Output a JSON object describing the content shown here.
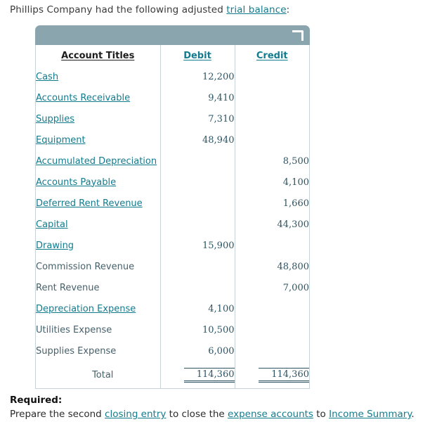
{
  "intro": {
    "text_before": "Phillips Company had the following adjusted ",
    "link": "trial balance",
    "text_after": ":"
  },
  "table": {
    "header_bar": {
      "corner_icon": "corner-bracket-icon"
    },
    "columns": {
      "account": "Account Titles",
      "debit": "Debit",
      "credit": "Credit"
    },
    "rows": [
      {
        "account": "Cash",
        "is_link": true,
        "debit": "12,200",
        "credit": ""
      },
      {
        "account": "Accounts Receivable",
        "is_link": true,
        "debit": "9,410",
        "credit": ""
      },
      {
        "account": "Supplies",
        "is_link": true,
        "debit": "7,310",
        "credit": ""
      },
      {
        "account": "Equipment",
        "is_link": true,
        "debit": "48,940",
        "credit": ""
      },
      {
        "account": "Accumulated Depreciation",
        "is_link": true,
        "debit": "",
        "credit": "8,500"
      },
      {
        "account": "Accounts Payable",
        "is_link": true,
        "debit": "",
        "credit": "4,100"
      },
      {
        "account": "Deferred Rent Revenue",
        "is_link": true,
        "debit": "",
        "credit": "1,660"
      },
      {
        "account": "Capital",
        "is_link": true,
        "debit": "",
        "credit": "44,300"
      },
      {
        "account": "Drawing",
        "is_link": true,
        "debit": "15,900",
        "credit": ""
      },
      {
        "account": "Commission Revenue",
        "is_link": false,
        "debit": "",
        "credit": "48,800"
      },
      {
        "account": "Rent Revenue",
        "is_link": false,
        "debit": "",
        "credit": "7,000"
      },
      {
        "account": "Depreciation Expense",
        "is_link": true,
        "debit": "4,100",
        "credit": ""
      },
      {
        "account": "Utilities Expense",
        "is_link": false,
        "debit": "10,500",
        "credit": ""
      },
      {
        "account": "Supplies Expense",
        "is_link": false,
        "debit": "6,000",
        "credit": ""
      }
    ],
    "total": {
      "label": "Total",
      "debit": "114,360",
      "credit": "114,360"
    }
  },
  "required": {
    "title": "Required:",
    "line": {
      "p1": "Prepare the second ",
      "l1": "closing entry",
      "p2": " to close the ",
      "l2": "expense accounts",
      "p3": " to ",
      "l3": "Income Summary",
      "p4": "."
    }
  },
  "colors": {
    "link": "#137b8e",
    "header_bar": "#8aa5ad",
    "number_text": "#2e5463",
    "border": "#c9d4d8"
  }
}
